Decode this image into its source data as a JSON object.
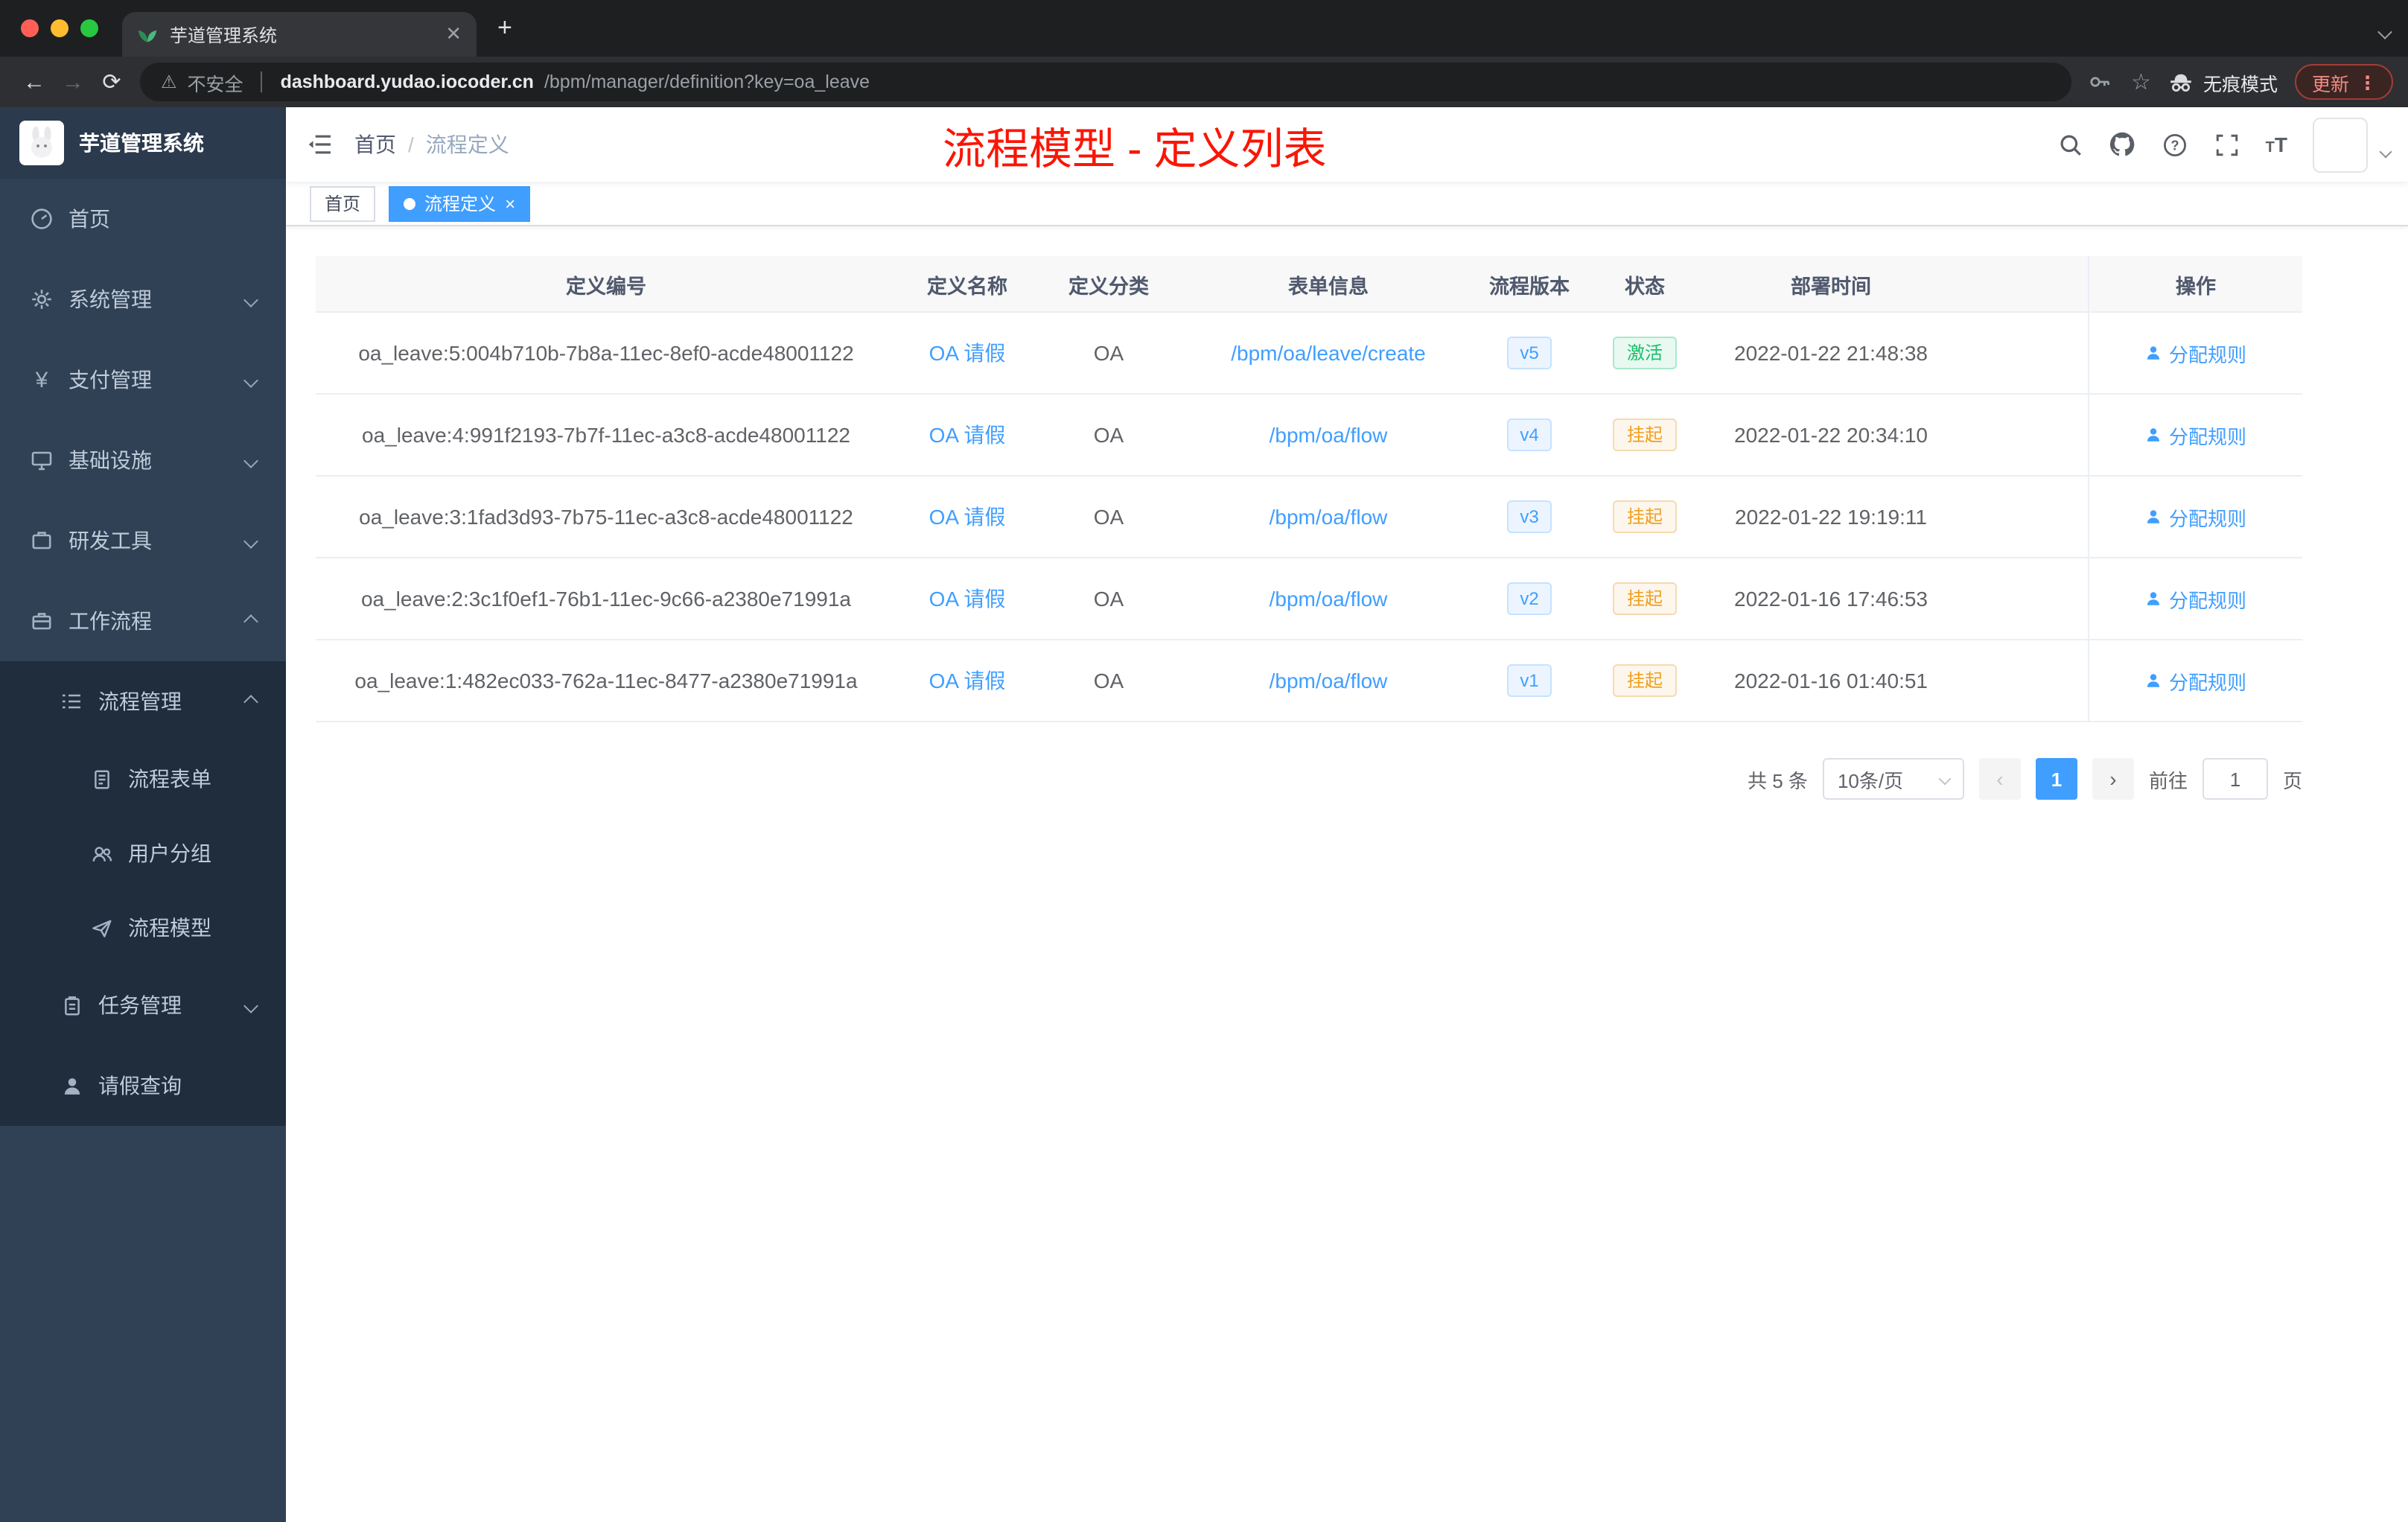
{
  "colors": {
    "accent": "#409eff",
    "annotation_red": "#fb1505",
    "status_active_green": "#19be6b",
    "status_suspend_orange": "#f0a020",
    "sidebar_bg": "#304156",
    "submenu_bg": "#1f2d3d"
  },
  "browser": {
    "tab": {
      "title": "芋道管理系统"
    },
    "toolbar": {
      "security_label": "不安全",
      "url_host": "dashboard.yudao.iocoder.cn",
      "url_path": "/bpm/manager/definition?key=oa_leave",
      "incognito_label": "无痕模式",
      "update_label": "更新"
    }
  },
  "sidebar": {
    "logo_title": "芋道管理系统",
    "items": [
      {
        "label": "首页"
      },
      {
        "label": "系统管理"
      },
      {
        "label": "支付管理"
      },
      {
        "label": "基础设施"
      },
      {
        "label": "研发工具"
      },
      {
        "label": "工作流程"
      }
    ],
    "process_group": {
      "label": "流程管理"
    },
    "process_children": [
      {
        "label": "流程表单"
      },
      {
        "label": "用户分组"
      },
      {
        "label": "流程模型"
      }
    ],
    "task_group": {
      "label": "任务管理"
    },
    "leave_item": {
      "label": "请假查询"
    }
  },
  "header": {
    "breadcrumb": [
      "首页",
      "流程定义"
    ],
    "overlay_title": "流程模型 - 定义列表"
  },
  "tags": [
    {
      "label": "首页"
    },
    {
      "label": "流程定义"
    }
  ],
  "table": {
    "columns": [
      "定义编号",
      "定义名称",
      "定义分类",
      "表单信息",
      "流程版本",
      "状态",
      "部署时间",
      "操作"
    ],
    "action_label": "分配规则",
    "rows": [
      {
        "id": "oa_leave:5:004b710b-7b8a-11ec-8ef0-acde48001122",
        "name": "OA 请假",
        "category": "OA",
        "form": "/bpm/oa/leave/create",
        "version": "v5",
        "status": "激活",
        "time": "2022-01-22 21:48:38"
      },
      {
        "id": "oa_leave:4:991f2193-7b7f-11ec-a3c8-acde48001122",
        "name": "OA 请假",
        "category": "OA",
        "form": "/bpm/oa/flow",
        "version": "v4",
        "status": "挂起",
        "time": "2022-01-22 20:34:10"
      },
      {
        "id": "oa_leave:3:1fad3d93-7b75-11ec-a3c8-acde48001122",
        "name": "OA 请假",
        "category": "OA",
        "form": "/bpm/oa/flow",
        "version": "v3",
        "status": "挂起",
        "time": "2022-01-22 19:19:11"
      },
      {
        "id": "oa_leave:2:3c1f0ef1-76b1-11ec-9c66-a2380e71991a",
        "name": "OA 请假",
        "category": "OA",
        "form": "/bpm/oa/flow",
        "version": "v2",
        "status": "挂起",
        "time": "2022-01-16 17:46:53"
      },
      {
        "id": "oa_leave:1:482ec033-762a-11ec-8477-a2380e71991a",
        "name": "OA 请假",
        "category": "OA",
        "form": "/bpm/oa/flow",
        "version": "v1",
        "status": "挂起",
        "time": "2022-01-16 01:40:51"
      }
    ]
  },
  "pagination": {
    "total": "共 5 条",
    "page_size": "10条/页",
    "current_page": "1",
    "goto_label": "前往",
    "goto_value": "1",
    "page_unit": "页"
  }
}
